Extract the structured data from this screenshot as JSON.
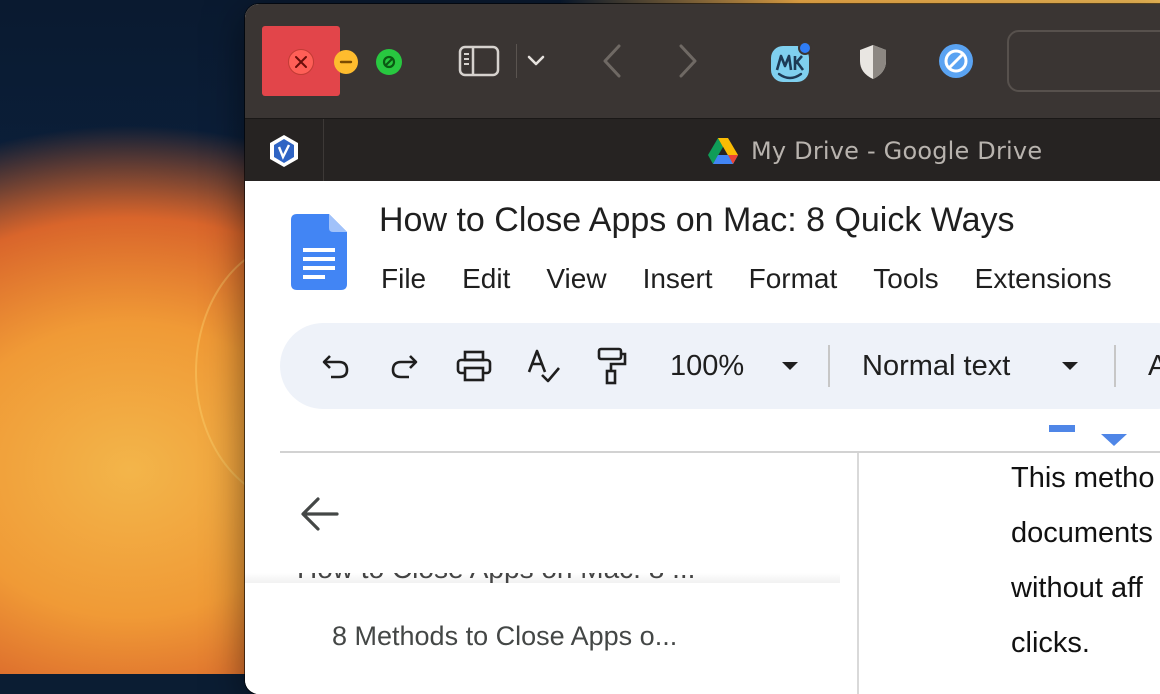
{
  "browser": {
    "tab_title": "My Drive - Google Drive"
  },
  "document": {
    "title": "How to Close Apps on Mac: 8 Quick Ways",
    "menu": [
      "File",
      "Edit",
      "View",
      "Insert",
      "Format",
      "Tools",
      "Extensions"
    ],
    "toolbar": {
      "zoom": "100%",
      "style": "Normal text",
      "font_partial": "A"
    },
    "outline": {
      "truncated_heading": "How to Close Apps on Mac: 8 ...",
      "item": "8 Methods to Close Apps o..."
    },
    "body_lines": [
      "This metho",
      "documents",
      "without aff",
      "clicks."
    ]
  },
  "colors": {
    "highlight_frame": "#e2454a",
    "docs_blue": "#4285f4",
    "titlebar": "#3a3533",
    "tabbar": "#262322"
  },
  "icons": {
    "traffic_lights": [
      "close-icon",
      "minimize-icon",
      "zoom-icon"
    ],
    "toolbar": [
      "undo-icon",
      "redo-icon",
      "print-icon",
      "spellcheck-icon",
      "paint-format-icon"
    ]
  }
}
